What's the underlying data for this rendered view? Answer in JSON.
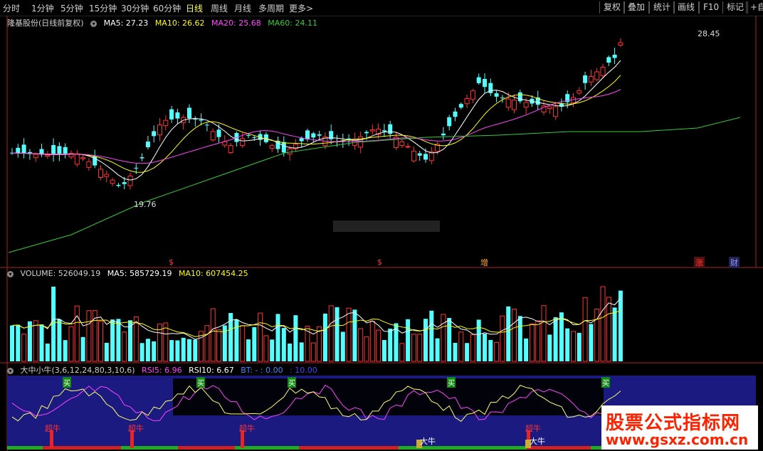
{
  "toolbar": {
    "periods": [
      "分时",
      "1分钟",
      "5分钟",
      "15分钟",
      "30分钟",
      "60分钟",
      "日线",
      "周线",
      "月线",
      "多周期",
      "更多>"
    ],
    "active": "日线",
    "right": [
      "复权",
      "叠加",
      "统计",
      "画线",
      "F10",
      "标记",
      "+自"
    ]
  },
  "main_legend": {
    "title": "隆基股份(日线前复权)",
    "ma5": "MA5: 27.23",
    "ma10": "MA10: 26.62",
    "ma20": "MA20: 25.68",
    "ma60": "MA60: 24.11",
    "colors": {
      "ma5": "#ffffff",
      "ma10": "#ffff00",
      "ma20": "#ff44ff",
      "ma60": "#33cc33"
    }
  },
  "annotations": {
    "high": "28.45",
    "low": "19.76",
    "markers": [
      {
        "text": "$",
        "color": "#ff3333"
      },
      {
        "text": "$",
        "color": "#ff3333"
      },
      {
        "text": "增",
        "color": "#ffaa33"
      },
      {
        "text": "涨",
        "color": "#ff3333"
      },
      {
        "text": "财",
        "color": "#9999ff"
      }
    ]
  },
  "volume_legend": {
    "volume": "VOLUME: 526049.19",
    "ma5": "MA5: 585729.19",
    "ma10": "MA10: 607454.25"
  },
  "indicator_legend": {
    "name": "大中小牛(3,6,12,24,80,3,10,6)",
    "rsi5": "RSI5: 6.96",
    "rsi10": "RSI10: 6.67",
    "bt": "BT: - : 0.00",
    "v": ": 10.00"
  },
  "signals": {
    "buy": "买",
    "super_bull": "超牛",
    "big_bull": "大牛"
  },
  "watermark": {
    "line1": "股票公式指标网",
    "line2": "www.gsxz.com.cn"
  },
  "chart_data": {
    "type": "candlestick",
    "price_high": 28.45,
    "price_low": 19.76,
    "colors": {
      "up": "#ff3333",
      "down": "#54ffff"
    },
    "series": [
      {
        "name": "MA5",
        "value": 27.23
      },
      {
        "name": "MA10",
        "value": 26.62
      },
      {
        "name": "MA20",
        "value": 25.68
      },
      {
        "name": "MA60",
        "value": 24.11
      }
    ]
  }
}
